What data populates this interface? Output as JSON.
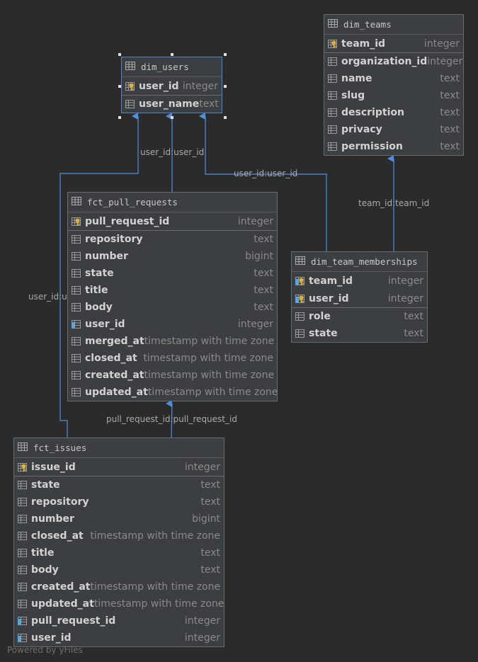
{
  "colors": {
    "background": "#2b2b2b",
    "table_bg": "#3c3f41",
    "edge": "#4f8fe0",
    "key_gold": "#e2b13c",
    "fk_blue": "#4fa6e8"
  },
  "tables": {
    "dim_users": {
      "title": "dim_users",
      "pk_columns": [
        {
          "name": "user_id",
          "type": "integer",
          "icon": "primary-key-icon"
        }
      ],
      "columns": [
        {
          "name": "user_name",
          "type": "text",
          "icon": "column-icon"
        }
      ]
    },
    "dim_teams": {
      "title": "dim_teams",
      "pk_columns": [
        {
          "name": "team_id",
          "type": "integer",
          "icon": "primary-key-icon"
        }
      ],
      "columns": [
        {
          "name": "organization_id",
          "type": "integer",
          "icon": "column-icon"
        },
        {
          "name": "name",
          "type": "text",
          "icon": "column-icon"
        },
        {
          "name": "slug",
          "type": "text",
          "icon": "column-icon"
        },
        {
          "name": "description",
          "type": "text",
          "icon": "column-icon"
        },
        {
          "name": "privacy",
          "type": "text",
          "icon": "column-icon"
        },
        {
          "name": "permission",
          "type": "text",
          "icon": "column-icon"
        }
      ]
    },
    "fct_pull_requests": {
      "title": "fct_pull_requests",
      "pk_columns": [
        {
          "name": "pull_request_id",
          "type": "integer",
          "icon": "primary-key-icon"
        }
      ],
      "columns": [
        {
          "name": "repository",
          "type": "text",
          "icon": "column-icon"
        },
        {
          "name": "number",
          "type": "bigint",
          "icon": "column-icon"
        },
        {
          "name": "state",
          "type": "text",
          "icon": "column-icon"
        },
        {
          "name": "title",
          "type": "text",
          "icon": "column-icon"
        },
        {
          "name": "body",
          "type": "text",
          "icon": "column-icon"
        },
        {
          "name": "user_id",
          "type": "integer",
          "icon": "foreign-key-icon"
        },
        {
          "name": "merged_at",
          "type": "timestamp with time zone",
          "icon": "column-icon"
        },
        {
          "name": "closed_at",
          "type": "timestamp with time zone",
          "icon": "column-icon"
        },
        {
          "name": "created_at",
          "type": "timestamp with time zone",
          "icon": "column-icon"
        },
        {
          "name": "updated_at",
          "type": "timestamp with time zone",
          "icon": "column-icon"
        }
      ]
    },
    "dim_team_memberships": {
      "title": "dim_team_memberships",
      "pk_columns": [
        {
          "name": "team_id",
          "type": "integer",
          "icon": "primary-foreign-key-icon"
        },
        {
          "name": "user_id",
          "type": "integer",
          "icon": "primary-foreign-key-icon"
        }
      ],
      "columns": [
        {
          "name": "role",
          "type": "text",
          "icon": "column-icon"
        },
        {
          "name": "state",
          "type": "text",
          "icon": "column-icon"
        }
      ]
    },
    "fct_issues": {
      "title": "fct_issues",
      "pk_columns": [
        {
          "name": "issue_id",
          "type": "integer",
          "icon": "primary-key-icon"
        }
      ],
      "columns": [
        {
          "name": "state",
          "type": "text",
          "icon": "column-icon"
        },
        {
          "name": "repository",
          "type": "text",
          "icon": "column-icon"
        },
        {
          "name": "number",
          "type": "bigint",
          "icon": "column-icon"
        },
        {
          "name": "closed_at",
          "type": "timestamp with time zone",
          "icon": "column-icon"
        },
        {
          "name": "title",
          "type": "text",
          "icon": "column-icon"
        },
        {
          "name": "body",
          "type": "text",
          "icon": "column-icon"
        },
        {
          "name": "created_at",
          "type": "timestamp with time zone",
          "icon": "column-icon"
        },
        {
          "name": "updated_at",
          "type": "timestamp with time zone",
          "icon": "column-icon"
        },
        {
          "name": "pull_request_id",
          "type": "integer",
          "icon": "foreign-key-icon"
        },
        {
          "name": "user_id",
          "type": "integer",
          "icon": "foreign-key-icon"
        }
      ]
    }
  },
  "edges": [
    {
      "from": "fct_pull_requests",
      "to": "dim_users",
      "label": "user_id:user_id"
    },
    {
      "from": "dim_team_memberships",
      "to": "dim_users",
      "label": "user_id:user_id"
    },
    {
      "from": "fct_issues",
      "to": "dim_users",
      "label": "user_id:user_id"
    },
    {
      "from": "dim_team_memberships",
      "to": "dim_teams",
      "label": "team_id:team_id"
    },
    {
      "from": "fct_issues",
      "to": "fct_pull_requests",
      "label": "pull_request_id:pull_request_id"
    }
  ],
  "footer": "Powered by yFiles"
}
